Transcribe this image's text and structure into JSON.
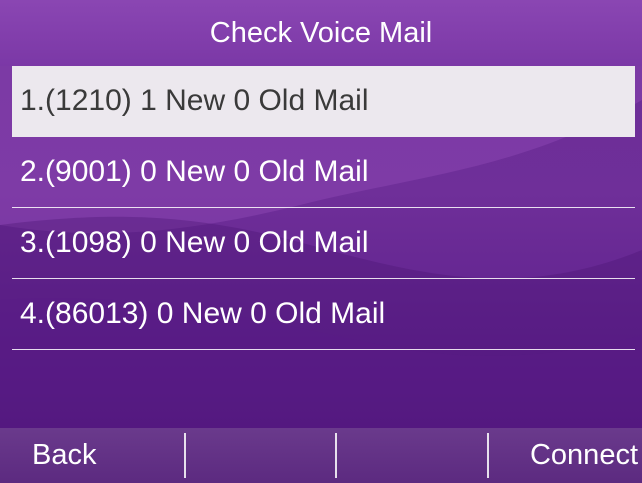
{
  "header": {
    "title": "Check Voice Mail"
  },
  "mailboxes": [
    {
      "label": "1.(1210) 1 New 0 Old Mail",
      "selected": true
    },
    {
      "label": "2.(9001) 0 New 0 Old Mail",
      "selected": false
    },
    {
      "label": "3.(1098) 0 New 0 Old Mail",
      "selected": false
    },
    {
      "label": "4.(86013) 0 New 0 Old Mail",
      "selected": false
    }
  ],
  "softkeys": {
    "key1": "Back",
    "key2": "",
    "key3": "",
    "key4": "Connect"
  },
  "colors": {
    "background": "#6a2d97",
    "selected_row": "#ece8ee",
    "text": "#ffffff"
  }
}
